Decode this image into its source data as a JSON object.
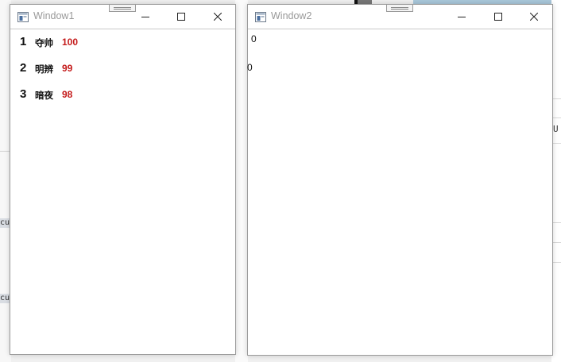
{
  "window1": {
    "title": "Window1",
    "ranking": [
      {
        "rank": "1",
        "name": "夺帅",
        "score": "100"
      },
      {
        "rank": "2",
        "name": "明辨",
        "score": "99"
      },
      {
        "rank": "3",
        "name": "暗夜",
        "score": "98"
      }
    ]
  },
  "window2": {
    "title": "Window2",
    "value_a": "0",
    "value_b": "0"
  },
  "background": {
    "right_glyph": "U",
    "left_chip_1": "cu",
    "left_chip_2": "cu"
  },
  "colors": {
    "score": "#c41a1a",
    "title_text": "#999999",
    "window_border": "#9a9a9a"
  }
}
